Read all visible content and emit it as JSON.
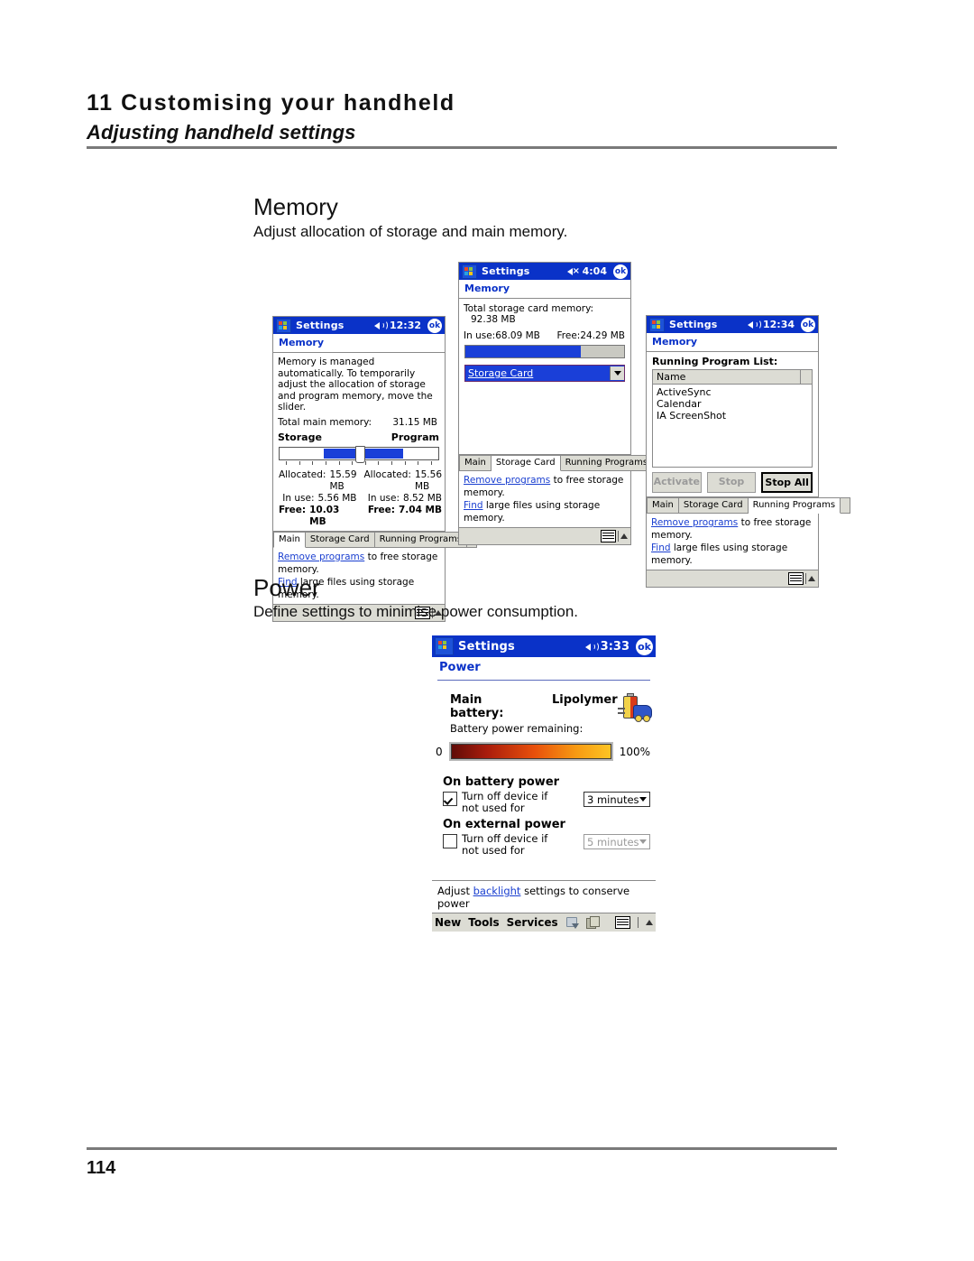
{
  "page": {
    "chapter_title": "11 Customising your handheld",
    "section_subtitle": "Adjusting handheld settings",
    "page_number": "114"
  },
  "sections": {
    "memory": {
      "heading": "Memory",
      "description": "Adjust allocation of storage and main memory."
    },
    "power": {
      "heading": "Power",
      "description": "Define settings to minimise power consumption."
    }
  },
  "common": {
    "app_title": "Settings",
    "ok_label": "ok",
    "subtitle_memory": "Memory",
    "subtitle_power": "Power",
    "tab_main": "Main",
    "tab_storage_card": "Storage Card",
    "tab_running_programs": "Running Programs",
    "link_remove_programs": "Remove programs",
    "link_remove_tail": " to free storage memory.",
    "link_find": "Find",
    "link_find_tail": " large files using storage memory.",
    "icon_keyboard": "keyboard-icon",
    "icon_up": "up-arrow-icon",
    "icon_speaker": "speaker-icon",
    "icon_speaker_muted": "speaker-muted-icon",
    "icon_start": "windows-start-icon"
  },
  "screenshot_memory_main": {
    "time": "12:32",
    "intro": "Memory is managed automatically. To temporarily adjust the allocation of storage and program memory, move the slider.",
    "total_label": "Total main memory:",
    "total_value": "31.15 MB",
    "storage_label": "Storage",
    "program_label": "Program",
    "storage": {
      "allocated_label": "Allocated:",
      "allocated_value": "15.59 MB",
      "inuse_label": "In use:",
      "inuse_value": "5.56 MB",
      "free_label": "Free:",
      "free_value": "10.03 MB"
    },
    "program": {
      "allocated_label": "Allocated:",
      "allocated_value": "15.56 MB",
      "inuse_label": "In use:",
      "inuse_value": "8.52 MB",
      "free_label": "Free:",
      "free_value": "7.04 MB"
    }
  },
  "screenshot_memory_storage": {
    "time": "4:04",
    "total_label": "Total storage card memory:",
    "total_value": "92.38 MB",
    "inuse_label": "In use:",
    "inuse_value": "68.09 MB",
    "free_label": "Free:",
    "free_value": "24.29 MB",
    "selected_card": "Storage Card"
  },
  "screenshot_memory_running": {
    "time": "12:34",
    "list_label": "Running Program List:",
    "column_name": "Name",
    "programs": [
      "ActiveSync",
      "Calendar",
      "IA ScreenShot"
    ],
    "btn_activate": "Activate",
    "btn_stop": "Stop",
    "btn_stop_all": "Stop All"
  },
  "screenshot_power": {
    "time": "3:33",
    "main_battery_label": "Main battery:",
    "main_battery_value": "Lipolymer",
    "remaining_label": "Battery power remaining:",
    "gauge_min": "0",
    "gauge_max": "100%",
    "group_battery": "On battery power",
    "group_external": "On external power",
    "turn_off_text": "Turn off device if not used for",
    "battery_timeout": "3 minutes",
    "external_timeout": "5 minutes",
    "battery_checked": true,
    "external_checked": false,
    "adjust_prefix": "Adjust ",
    "adjust_link": "backlight",
    "adjust_suffix": " settings to conserve power",
    "menu_new": "New",
    "menu_tools": "Tools",
    "menu_services": "Services"
  }
}
